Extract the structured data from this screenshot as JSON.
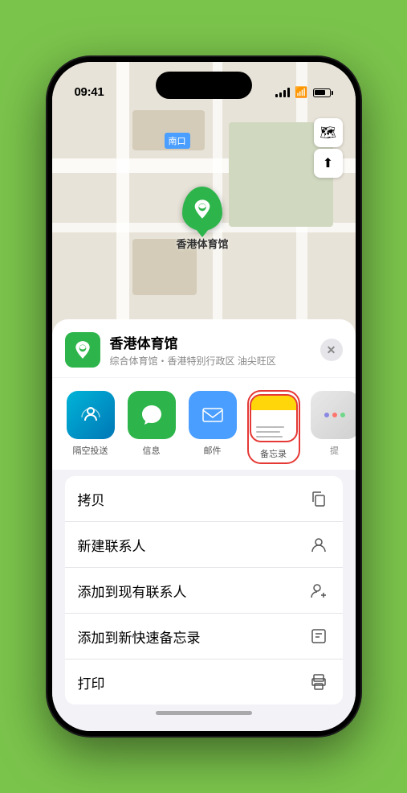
{
  "status_bar": {
    "time": "09:41",
    "location_active": true
  },
  "map": {
    "label": "南口",
    "venue_name_on_map": "香港体育馆"
  },
  "venue_header": {
    "name": "香港体育馆",
    "subtitle": "综合体育馆・香港特别行政区 油尖旺区"
  },
  "share_items": [
    {
      "id": "airdrop",
      "label": "隔空投送"
    },
    {
      "id": "messages",
      "label": "信息"
    },
    {
      "id": "mail",
      "label": "邮件"
    },
    {
      "id": "notes",
      "label": "备忘录"
    },
    {
      "id": "more",
      "label": "提"
    }
  ],
  "actions": [
    {
      "id": "copy",
      "label": "拷贝",
      "icon": "📋"
    },
    {
      "id": "new-contact",
      "label": "新建联系人",
      "icon": "👤"
    },
    {
      "id": "add-existing",
      "label": "添加到现有联系人",
      "icon": "👤"
    },
    {
      "id": "add-notes",
      "label": "添加到新快速备忘录",
      "icon": "🗒"
    },
    {
      "id": "print",
      "label": "打印",
      "icon": "🖨"
    }
  ],
  "colors": {
    "green": "#2db54b",
    "blue": "#4a9eff",
    "red": "#e53935",
    "notes_yellow": "#FFD60A"
  }
}
